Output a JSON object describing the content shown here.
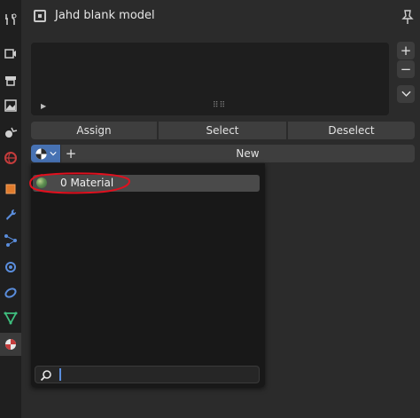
{
  "header": {
    "object_name": "Jahd blank model"
  },
  "material_slots": {
    "slot_side_buttons": [
      "+",
      "−"
    ]
  },
  "assign_row": {
    "assign_label": "Assign",
    "select_label": "Select",
    "deselect_label": "Deselect"
  },
  "new_row": {
    "plus_label": "+",
    "new_label": "New"
  },
  "material_popup": {
    "items": [
      {
        "label": "0 Material"
      }
    ],
    "search": {
      "value": "",
      "placeholder": ""
    }
  },
  "tabs": [
    "tool",
    "render",
    "output",
    "view-layer",
    "scene",
    "world",
    "object",
    "modifiers",
    "particles",
    "physics",
    "constraints",
    "data",
    "material"
  ],
  "colors": {
    "accent": "#4772b3",
    "annotation_red": "#e0101e"
  }
}
